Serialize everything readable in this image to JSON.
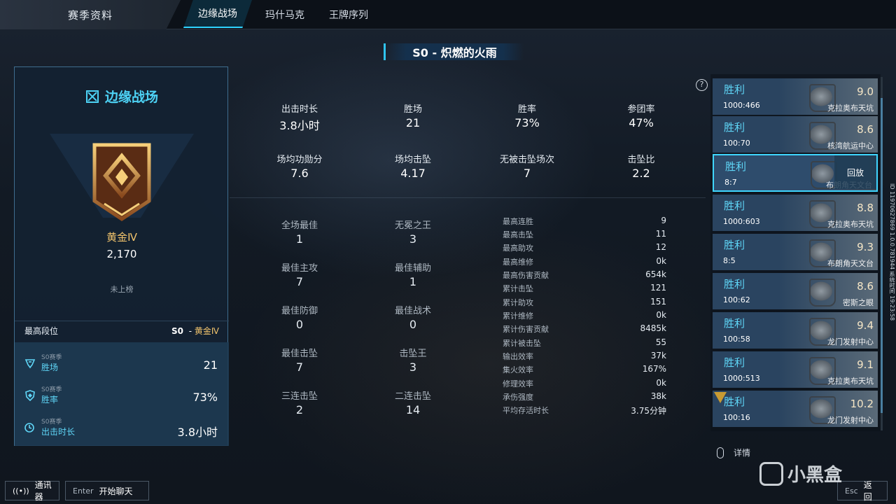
{
  "topbar": {
    "main_tab": "赛季资料",
    "tabs": [
      "边缘战场",
      "玛什马克",
      "王牌序列"
    ]
  },
  "season_title": "S0 - 炽燃的火雨",
  "left_panel": {
    "mode_title": "边缘战场",
    "rank_name": "黄金Ⅳ",
    "rank_score": "2,170",
    "unranked": "未上榜",
    "best_rank_label": "最高段位",
    "best_rank_season": "S0",
    "best_rank_sep": " - ",
    "best_rank_value": "黄金Ⅳ",
    "stats": [
      {
        "sub": "S0赛季",
        "label": "胜场",
        "value": "21",
        "icon": "trophy-icon"
      },
      {
        "sub": "S0赛季",
        "label": "胜率",
        "value": "73%",
        "icon": "shield-icon"
      },
      {
        "sub": "S0赛季",
        "label": "出击时长",
        "value": "3.8小时",
        "icon": "clock-icon"
      }
    ],
    "accent": "#4dd2f5",
    "gold": "#f1c36c"
  },
  "main_stats": [
    {
      "label": "出击时长",
      "value": "3.8小时"
    },
    {
      "label": "胜场",
      "value": "21"
    },
    {
      "label": "胜率",
      "value": "73%"
    },
    {
      "label": "参团率",
      "value": "47%"
    },
    {
      "label": "场均功勋分",
      "value": "7.6"
    },
    {
      "label": "场均击坠",
      "value": "4.17"
    },
    {
      "label": "无被击坠场次",
      "value": "7"
    },
    {
      "label": "击坠比",
      "value": "2.2"
    }
  ],
  "awards": [
    {
      "label": "全场最佳",
      "value": "1"
    },
    {
      "label": "无冕之王",
      "value": "3"
    },
    {
      "label": "最佳主攻",
      "value": "7"
    },
    {
      "label": "最佳辅助",
      "value": "1"
    },
    {
      "label": "最佳防御",
      "value": "0"
    },
    {
      "label": "最佳战术",
      "value": "0"
    },
    {
      "label": "最佳击坠",
      "value": "7"
    },
    {
      "label": "击坠王",
      "value": "3"
    },
    {
      "label": "三连击坠",
      "value": "2"
    },
    {
      "label": "二连击坠",
      "value": "14"
    }
  ],
  "records": [
    {
      "label": "最高连胜",
      "value": "9"
    },
    {
      "label": "最高击坠",
      "value": "11"
    },
    {
      "label": "最高助攻",
      "value": "12"
    },
    {
      "label": "最高维修",
      "value": "0k"
    },
    {
      "label": "最高伤害贡献",
      "value": "654k"
    },
    {
      "label": "累计击坠",
      "value": "121"
    },
    {
      "label": "累计助攻",
      "value": "151"
    },
    {
      "label": "累计维修",
      "value": "0k"
    },
    {
      "label": "累计伤害贡献",
      "value": "8485k"
    },
    {
      "label": "累计被击坠",
      "value": "55"
    },
    {
      "label": "输出效率",
      "value": "37k"
    },
    {
      "label": "集火效率",
      "value": "167%"
    },
    {
      "label": "修理效率",
      "value": "0k"
    },
    {
      "label": "承伤强度",
      "value": "38k"
    },
    {
      "label": "平均存活时长",
      "value": "3.75分钟"
    }
  ],
  "matches": [
    {
      "result": "胜利",
      "score": "1000:466",
      "rating": "9.0",
      "map": "克拉奥布天坑"
    },
    {
      "result": "胜利",
      "score": "100:70",
      "rating": "8.6",
      "map": "核湾航运中心"
    },
    {
      "result": "胜利",
      "score": "8:7",
      "rating": "",
      "map": "布朗角天文台",
      "selected": true,
      "replay": "回放"
    },
    {
      "result": "胜利",
      "score": "1000:603",
      "rating": "8.8",
      "map": "克拉奥布天坑"
    },
    {
      "result": "胜利",
      "score": "8:5",
      "rating": "9.3",
      "map": "布朗角天文台"
    },
    {
      "result": "胜利",
      "score": "100:62",
      "rating": "8.6",
      "map": "密斯之眼"
    },
    {
      "result": "胜利",
      "score": "100:58",
      "rating": "9.4",
      "map": "龙门发射中心"
    },
    {
      "result": "胜利",
      "score": "1000:513",
      "rating": "9.1",
      "map": "克拉奥布天坑"
    },
    {
      "result": "胜利",
      "score": "100:16",
      "rating": "10.2",
      "map": "龙门发射中心",
      "mvp": true
    }
  ],
  "side_info": {
    "text": "ID 11970627869  1.0.0.781944  系统时间  19:23:58"
  },
  "bottom": {
    "details": "详情",
    "comm": "通讯器",
    "enter_key": "Enter",
    "chat": "开始聊天",
    "esc_key": "Esc",
    "back": "返回",
    "watermark": "小黑盒"
  }
}
